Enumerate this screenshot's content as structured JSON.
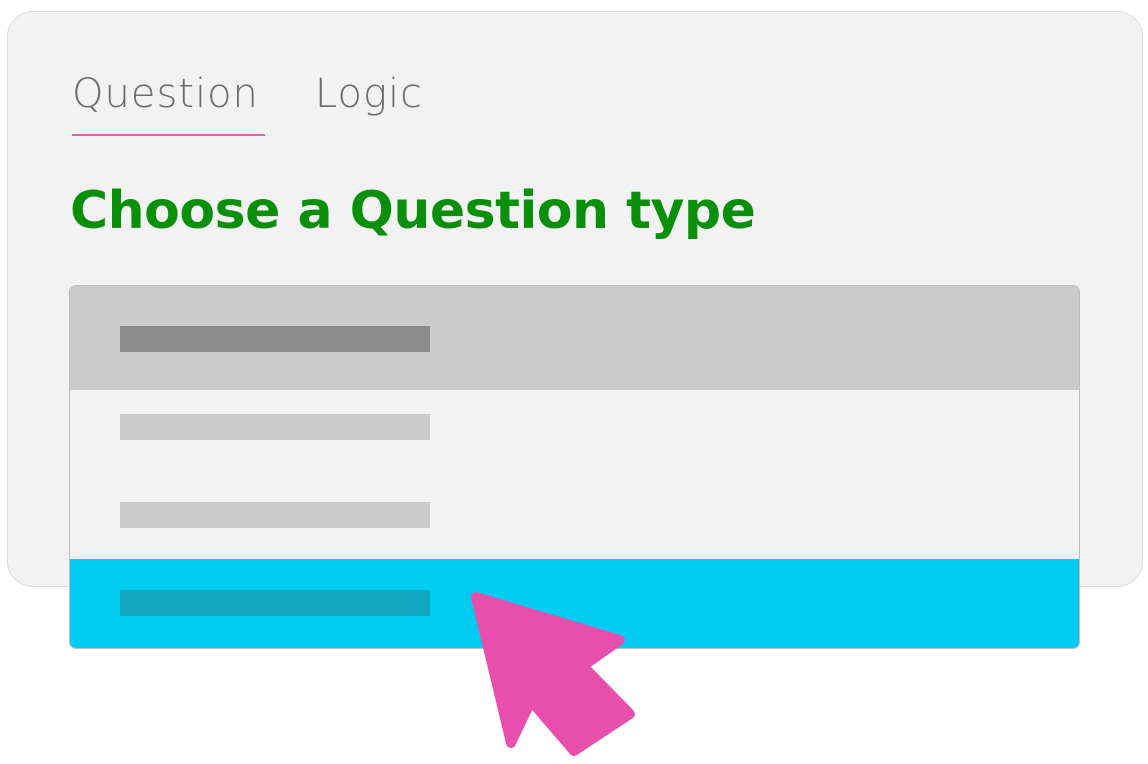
{
  "tabs": [
    {
      "label": "Question",
      "active": true
    },
    {
      "label": "Logic",
      "active": false
    }
  ],
  "heading": "Choose a Question type",
  "dropdown": {
    "options": [
      "header-placeholder",
      "option-1-placeholder",
      "option-2-placeholder",
      "option-3-placeholder"
    ],
    "highlighted_index": 3
  },
  "colors": {
    "accent_pink": "#e85bb0",
    "heading_green": "#0a8f0a",
    "highlight_cyan": "#00ccf2"
  },
  "icons": {
    "cursor": "pointer-cursor-icon"
  }
}
